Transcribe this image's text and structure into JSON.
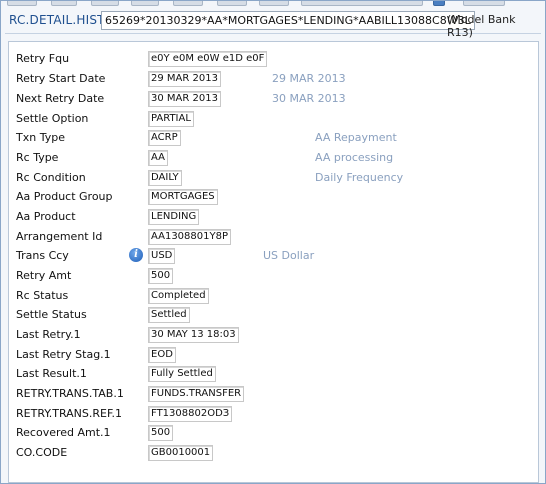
{
  "header": {
    "app_title": "RC.DETAIL.HIST",
    "record_id": "65269*20130329*AA*MORTGAGES*LENDING*AABILL13088C8W3L",
    "company": "(Model Bank R13)"
  },
  "fields": [
    {
      "label": "Retry Fqu",
      "value": "e0Y e0M e0W e1D e0F"
    },
    {
      "label": "Retry Start Date",
      "value": "29 MAR 2013",
      "enrichment": "29 MAR 2013"
    },
    {
      "label": "Next Retry Date",
      "value": "30 MAR 2013",
      "enrichment": "30 MAR 2013"
    },
    {
      "label": "Settle Option",
      "value": "PARTIAL"
    },
    {
      "label": "Txn Type",
      "value": "ACRP",
      "enrichment": "AA Repayment"
    },
    {
      "label": "Rc Type",
      "value": "AA",
      "enrichment": "AA processing"
    },
    {
      "label": "Rc Condition",
      "value": "DAILY",
      "enrichment": "Daily Frequency"
    },
    {
      "label": "Aa Product Group",
      "value": "MORTGAGES"
    },
    {
      "label": "Aa Product",
      "value": "LENDING"
    },
    {
      "label": "Arrangement Id",
      "value": "AA1308801Y8P"
    },
    {
      "label": "Trans Ccy",
      "value": "USD",
      "enrichment": "US Dollar",
      "icon": "info-icon"
    },
    {
      "label": "Retry Amt",
      "value": "500"
    },
    {
      "label": "Rc Status",
      "value": "Completed"
    },
    {
      "label": "Settle Status",
      "value": "Settled"
    },
    {
      "label": "Last Retry.1",
      "value": "30 MAY 13 18:03"
    },
    {
      "label": "Last Retry Stag.1",
      "value": "EOD"
    },
    {
      "label": "Last Result.1",
      "value": "Fully Settled"
    },
    {
      "label": "RETRY.TRANS.TAB.1",
      "value": "FUNDS.TRANSFER"
    },
    {
      "label": "RETRY.TRANS.REF.1",
      "value": "FT1308802ODЗ"
    },
    {
      "label": "Recovered Amt.1",
      "value": "500"
    },
    {
      "label": "CO.CODE",
      "value": "GB0010001"
    }
  ],
  "info_icon_glyph": "i"
}
